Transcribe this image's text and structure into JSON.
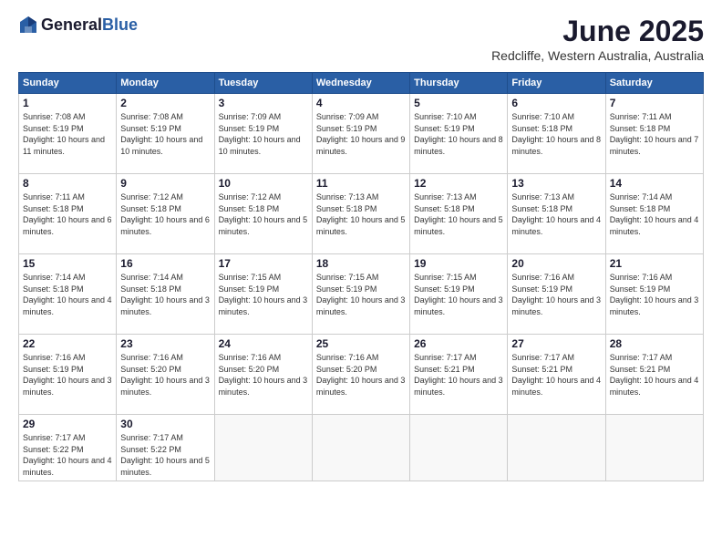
{
  "logo": {
    "general": "General",
    "blue": "Blue"
  },
  "title": "June 2025",
  "location": "Redcliffe, Western Australia, Australia",
  "headers": [
    "Sunday",
    "Monday",
    "Tuesday",
    "Wednesday",
    "Thursday",
    "Friday",
    "Saturday"
  ],
  "weeks": [
    [
      {
        "day": "1",
        "sunrise": "Sunrise: 7:08 AM",
        "sunset": "Sunset: 5:19 PM",
        "daylight": "Daylight: 10 hours and 11 minutes."
      },
      {
        "day": "2",
        "sunrise": "Sunrise: 7:08 AM",
        "sunset": "Sunset: 5:19 PM",
        "daylight": "Daylight: 10 hours and 10 minutes."
      },
      {
        "day": "3",
        "sunrise": "Sunrise: 7:09 AM",
        "sunset": "Sunset: 5:19 PM",
        "daylight": "Daylight: 10 hours and 10 minutes."
      },
      {
        "day": "4",
        "sunrise": "Sunrise: 7:09 AM",
        "sunset": "Sunset: 5:19 PM",
        "daylight": "Daylight: 10 hours and 9 minutes."
      },
      {
        "day": "5",
        "sunrise": "Sunrise: 7:10 AM",
        "sunset": "Sunset: 5:19 PM",
        "daylight": "Daylight: 10 hours and 8 minutes."
      },
      {
        "day": "6",
        "sunrise": "Sunrise: 7:10 AM",
        "sunset": "Sunset: 5:18 PM",
        "daylight": "Daylight: 10 hours and 8 minutes."
      },
      {
        "day": "7",
        "sunrise": "Sunrise: 7:11 AM",
        "sunset": "Sunset: 5:18 PM",
        "daylight": "Daylight: 10 hours and 7 minutes."
      }
    ],
    [
      {
        "day": "8",
        "sunrise": "Sunrise: 7:11 AM",
        "sunset": "Sunset: 5:18 PM",
        "daylight": "Daylight: 10 hours and 6 minutes."
      },
      {
        "day": "9",
        "sunrise": "Sunrise: 7:12 AM",
        "sunset": "Sunset: 5:18 PM",
        "daylight": "Daylight: 10 hours and 6 minutes."
      },
      {
        "day": "10",
        "sunrise": "Sunrise: 7:12 AM",
        "sunset": "Sunset: 5:18 PM",
        "daylight": "Daylight: 10 hours and 5 minutes."
      },
      {
        "day": "11",
        "sunrise": "Sunrise: 7:13 AM",
        "sunset": "Sunset: 5:18 PM",
        "daylight": "Daylight: 10 hours and 5 minutes."
      },
      {
        "day": "12",
        "sunrise": "Sunrise: 7:13 AM",
        "sunset": "Sunset: 5:18 PM",
        "daylight": "Daylight: 10 hours and 5 minutes."
      },
      {
        "day": "13",
        "sunrise": "Sunrise: 7:13 AM",
        "sunset": "Sunset: 5:18 PM",
        "daylight": "Daylight: 10 hours and 4 minutes."
      },
      {
        "day": "14",
        "sunrise": "Sunrise: 7:14 AM",
        "sunset": "Sunset: 5:18 PM",
        "daylight": "Daylight: 10 hours and 4 minutes."
      }
    ],
    [
      {
        "day": "15",
        "sunrise": "Sunrise: 7:14 AM",
        "sunset": "Sunset: 5:18 PM",
        "daylight": "Daylight: 10 hours and 4 minutes."
      },
      {
        "day": "16",
        "sunrise": "Sunrise: 7:14 AM",
        "sunset": "Sunset: 5:18 PM",
        "daylight": "Daylight: 10 hours and 3 minutes."
      },
      {
        "day": "17",
        "sunrise": "Sunrise: 7:15 AM",
        "sunset": "Sunset: 5:19 PM",
        "daylight": "Daylight: 10 hours and 3 minutes."
      },
      {
        "day": "18",
        "sunrise": "Sunrise: 7:15 AM",
        "sunset": "Sunset: 5:19 PM",
        "daylight": "Daylight: 10 hours and 3 minutes."
      },
      {
        "day": "19",
        "sunrise": "Sunrise: 7:15 AM",
        "sunset": "Sunset: 5:19 PM",
        "daylight": "Daylight: 10 hours and 3 minutes."
      },
      {
        "day": "20",
        "sunrise": "Sunrise: 7:16 AM",
        "sunset": "Sunset: 5:19 PM",
        "daylight": "Daylight: 10 hours and 3 minutes."
      },
      {
        "day": "21",
        "sunrise": "Sunrise: 7:16 AM",
        "sunset": "Sunset: 5:19 PM",
        "daylight": "Daylight: 10 hours and 3 minutes."
      }
    ],
    [
      {
        "day": "22",
        "sunrise": "Sunrise: 7:16 AM",
        "sunset": "Sunset: 5:19 PM",
        "daylight": "Daylight: 10 hours and 3 minutes."
      },
      {
        "day": "23",
        "sunrise": "Sunrise: 7:16 AM",
        "sunset": "Sunset: 5:20 PM",
        "daylight": "Daylight: 10 hours and 3 minutes."
      },
      {
        "day": "24",
        "sunrise": "Sunrise: 7:16 AM",
        "sunset": "Sunset: 5:20 PM",
        "daylight": "Daylight: 10 hours and 3 minutes."
      },
      {
        "day": "25",
        "sunrise": "Sunrise: 7:16 AM",
        "sunset": "Sunset: 5:20 PM",
        "daylight": "Daylight: 10 hours and 3 minutes."
      },
      {
        "day": "26",
        "sunrise": "Sunrise: 7:17 AM",
        "sunset": "Sunset: 5:21 PM",
        "daylight": "Daylight: 10 hours and 3 minutes."
      },
      {
        "day": "27",
        "sunrise": "Sunrise: 7:17 AM",
        "sunset": "Sunset: 5:21 PM",
        "daylight": "Daylight: 10 hours and 4 minutes."
      },
      {
        "day": "28",
        "sunrise": "Sunrise: 7:17 AM",
        "sunset": "Sunset: 5:21 PM",
        "daylight": "Daylight: 10 hours and 4 minutes."
      }
    ],
    [
      {
        "day": "29",
        "sunrise": "Sunrise: 7:17 AM",
        "sunset": "Sunset: 5:22 PM",
        "daylight": "Daylight: 10 hours and 4 minutes."
      },
      {
        "day": "30",
        "sunrise": "Sunrise: 7:17 AM",
        "sunset": "Sunset: 5:22 PM",
        "daylight": "Daylight: 10 hours and 5 minutes."
      },
      null,
      null,
      null,
      null,
      null
    ]
  ]
}
